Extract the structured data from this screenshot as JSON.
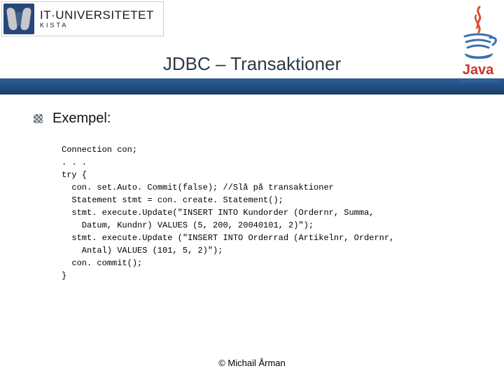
{
  "header": {
    "logo_main": "IT·UNIVERSITETET",
    "logo_sub": "KISTA",
    "title": "JDBC – Transaktioner"
  },
  "content": {
    "bullet_label": "Exempel:",
    "code": "Connection con;\n. . .\ntry {\n  con. set.Auto. Commit(false); //Slå på transaktioner\n  Statement stmt = con. create. Statement();\n  stmt. execute.Update(\"INSERT INTO Kundorder (Ordernr, Summa,\n    Datum, Kundnr) VALUES (5, 200, 20040101, 2)\");\n  stmt. execute.Update (\"INSERT INTO Orderrad (Artikelnr, Ordernr,\n    Antal) VALUES (101, 5, 2)\");\n  con. commit();\n}"
  },
  "footer": {
    "copyright": "© Michail Årman"
  }
}
